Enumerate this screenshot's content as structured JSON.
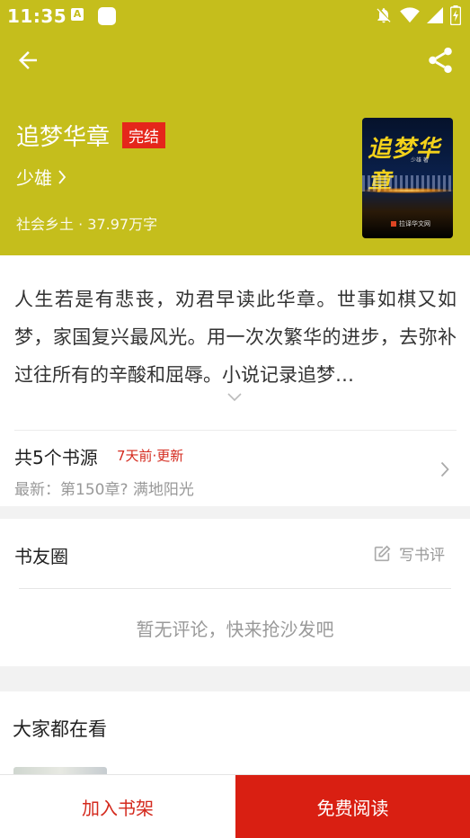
{
  "status_bar": {
    "time": "11:35",
    "notif_a": "A"
  },
  "book": {
    "title": "追梦华章",
    "status": "完结",
    "author": "少雄",
    "meta": "社会乡土 · 37.97万字",
    "cover_title": "追梦华章",
    "cover_author": "少雄 著",
    "cover_publisher": "拉译华文网"
  },
  "description": "人生若是有悲丧，劝君早读此华章。世事如棋又如梦，家国复兴最风光。用一次次繁华的进步，去弥补过往所有的辛酸和屈辱。小说记录追梦…",
  "sources": {
    "count_label": "共5个书源",
    "update_label": "7天前·更新",
    "latest_label": "最新：第150章? 满地阳光"
  },
  "circle": {
    "title": "书友圈",
    "write_label": "写书评",
    "empty_text": "暂无评论，快来抢沙发吧"
  },
  "popular": {
    "title": "大家都在看"
  },
  "bottom": {
    "add_shelf": "加入书架",
    "free_read": "免费阅读"
  },
  "colors": {
    "header_bg": "#c5be1c",
    "accent_red": "#d91f12",
    "update_red": "#d42a1e"
  }
}
